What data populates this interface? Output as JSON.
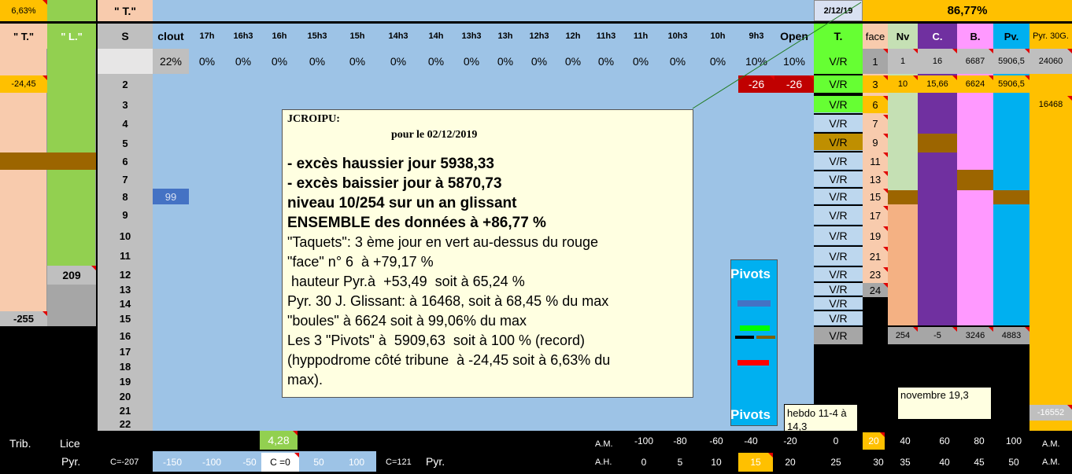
{
  "colors": {
    "blue_bg": "#9dc3e6",
    "peach": "#f8cbad",
    "green_lice": "#92d050",
    "grey": "#bfbfbf",
    "yellow": "#ffc000",
    "purple": "#7030a0",
    "pink": "#ff99ff",
    "cyan": "#00b0f0",
    "brown": "#9c6500",
    "red": "#c00000",
    "note_bg": "#ffffe1"
  },
  "top": {
    "pct_left": "6,63%",
    "t_quote": "\" T.\"",
    "date": "2/12/19",
    "pct_right": "86,77%"
  },
  "header": {
    "t_col": "\" T.\"",
    "l_col": "\" L.\"",
    "s_col": "S",
    "clout": "clout",
    "hours": [
      "17h",
      "16h3",
      "16h",
      "15h3",
      "15h",
      "14h3",
      "14h",
      "13h3",
      "13h",
      "12h3",
      "12h",
      "11h3",
      "11h",
      "10h3",
      "10h",
      "9h3"
    ],
    "open": "Open",
    "t_right": "T.",
    "face": "face",
    "nv": "Nv",
    "c": "C.",
    "b": "B.",
    "pv": "Pv.",
    "pyr30": "Pyr. 30G."
  },
  "row1": {
    "clout": "22%",
    "hours": [
      "0%",
      "0%",
      "0%",
      "0%",
      "0%",
      "0%",
      "0%",
      "0%",
      "0%",
      "0%",
      "0%",
      "0%",
      "0%",
      "0%",
      "0%",
      "10%"
    ],
    "open": "10%",
    "vr": "V/R",
    "face": "1",
    "nv": "1",
    "c": "16",
    "b": "6687",
    "pv": "5906,5",
    "pyr": "24060"
  },
  "row2": {
    "t_val": "-24,45",
    "s": "2",
    "neg1": "-26",
    "neg2": "-26",
    "vr": "V/R",
    "face": "3",
    "nv": "10",
    "c": "15,66",
    "b": "6624",
    "pv": "5906,5"
  },
  "row3": {
    "pyr": "16468"
  },
  "s_numbers": [
    "3",
    "4",
    "5",
    "6",
    "7",
    "8",
    "9",
    "10",
    "11",
    "12",
    "13",
    "14",
    "15",
    "16",
    "17",
    "18",
    "19",
    "20",
    "21",
    "22"
  ],
  "vr_list": [
    "V/R",
    "V/R",
    "V/R",
    "V/R",
    "V/R",
    "V/R",
    "V/R",
    "V/R",
    "V/R",
    "V/R",
    "V/R",
    "V/R",
    "V/R",
    "V/R"
  ],
  "face_list": [
    "6",
    "7",
    "9",
    "11",
    "13",
    "15",
    "17",
    "19",
    "21",
    "23",
    "24"
  ],
  "bottom_counts": {
    "vr": "V/R",
    "nv": "254",
    "c": "-5",
    "b": "3246",
    "pv": "4883"
  },
  "misc": {
    "val_99": "99",
    "l_209": "209",
    "t_255": "-255",
    "pyr_neg": "-16552",
    "pivots_top": "Pivots",
    "pivots_bottom": "Pivots",
    "hebdo": "hebdo 11-4 à 14,3",
    "novembre": "novembre 19,3"
  },
  "note": {
    "title": "JCROIPU:",
    "subtitle": "pour le 02/12/2019",
    "lines_bold": [
      "- excès haussier jour 5938,33",
      "- excès baissier jour à 5870,73",
      "niveau  10/254 sur un an glissant",
      "ENSEMBLE des données à +86,77 %"
    ],
    "lines": [
      "\"Taquets\": 3 ème jour en vert au-dessus du rouge",
      "\"face\" n° 6  à +79,17 %",
      " hauteur Pyr.à  +53,49  soit à 65,24 %",
      "Pyr. 30 J. Glissant: à 16468, soit à 68,45 % du max",
      "\"boules\" à 6624 soit à 99,06% du max",
      "Les 3 \"Pivots\" à  5909,63  soit à 100 % (record)",
      "(hyppodrome côté tribune  à -24,45 soit à 6,63% du",
      "max)."
    ]
  },
  "footer": {
    "trib": "Trib.",
    "lice": "Lice",
    "value_428": "4,28",
    "am_label": "A.M.",
    "am_values": [
      "-100",
      "-80",
      "-60",
      "-40",
      "-20",
      "0",
      "20",
      "40",
      "60",
      "80",
      "100"
    ],
    "am_label_right": "A.M.",
    "pyr_label": "Pyr.",
    "c_left": "C=-207",
    "scale": [
      "-150",
      "-100",
      "-50",
      "C =0",
      "50",
      "100"
    ],
    "c_right": "C=121",
    "pyr_label2": "Pyr.",
    "ah_label": "A.H.",
    "ah_values": [
      "0",
      "5",
      "10",
      "15",
      "20",
      "25",
      "30",
      "35",
      "40",
      "45",
      "50"
    ],
    "ah_label_right": "A.M."
  }
}
